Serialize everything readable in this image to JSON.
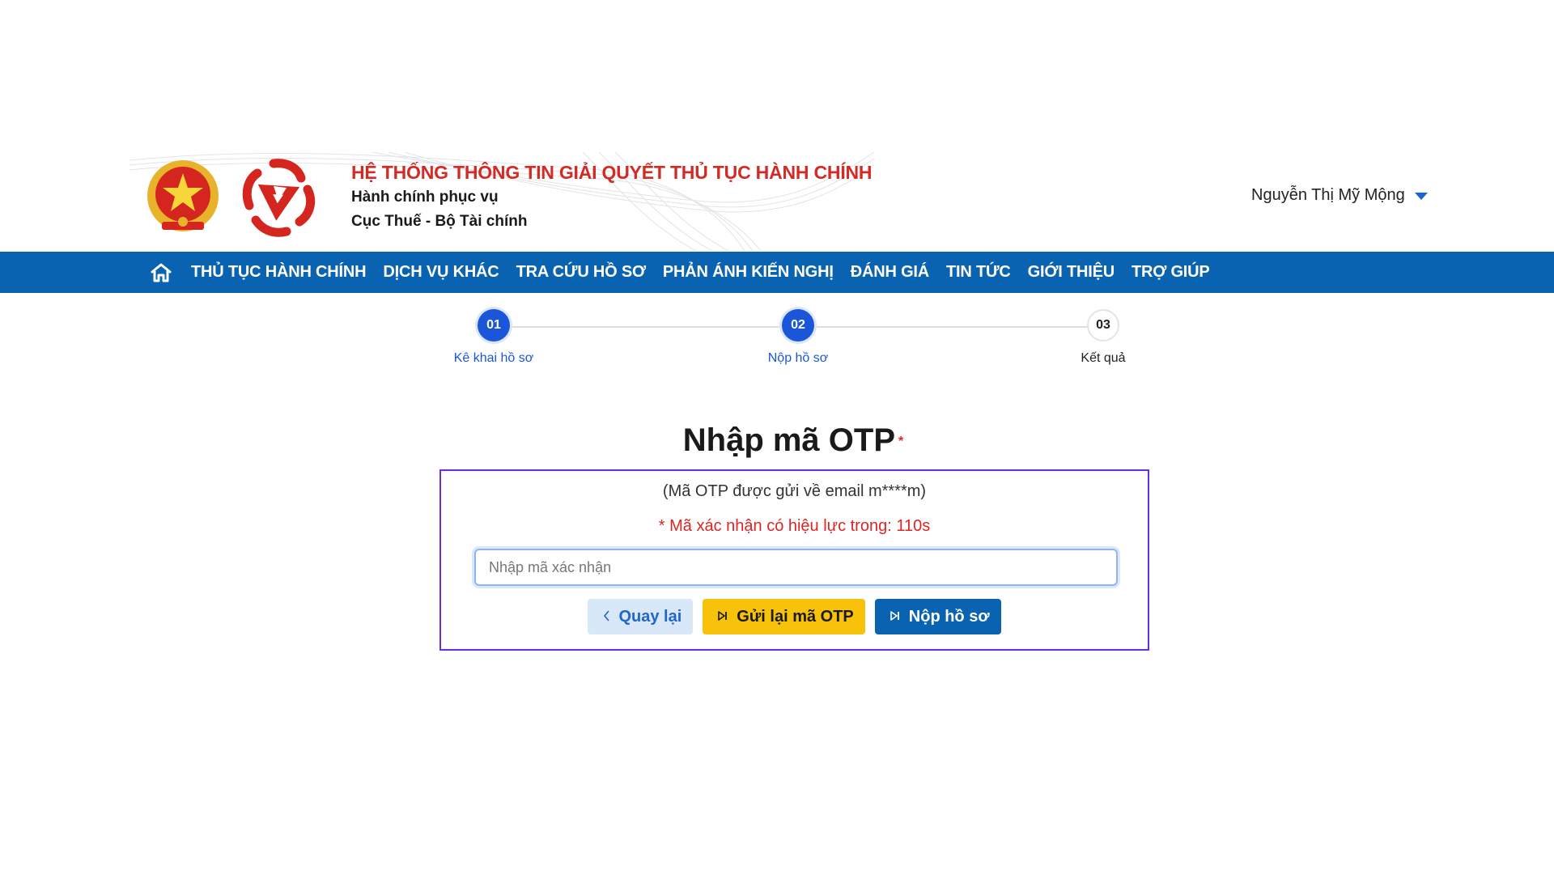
{
  "header": {
    "title": "HỆ THỐNG THÔNG TIN GIẢI QUYẾT THỦ TỤC HÀNH CHÍNH",
    "subtitle1": "Hành chính phục vụ",
    "subtitle2": "Cục Thuế - Bộ Tài chính",
    "user_name": "Nguyễn Thị Mỹ Mộng",
    "title_color": "#d42a24"
  },
  "nav": {
    "background": "#0a63b0",
    "items": [
      {
        "label": "THỦ TỤC HÀNH CHÍNH"
      },
      {
        "label": "DỊCH VỤ KHÁC"
      },
      {
        "label": "TRA CỨU HỒ SƠ"
      },
      {
        "label": "PHẢN ÁNH KIẾN NGHỊ"
      },
      {
        "label": "ĐÁNH GIÁ"
      },
      {
        "label": "TIN TỨC"
      },
      {
        "label": "GIỚI THIỆU"
      },
      {
        "label": "TRỢ GIÚP"
      }
    ]
  },
  "stepper": {
    "steps": [
      {
        "number": "01",
        "label": "Kê khai hồ sơ",
        "state": "active"
      },
      {
        "number": "02",
        "label": "Nộp hồ sơ",
        "state": "active"
      },
      {
        "number": "03",
        "label": "Kết quả",
        "state": "inactive"
      }
    ]
  },
  "otp": {
    "title": "Nhập mã OTP",
    "required_mark": "*",
    "note": "(Mã OTP được gửi về email m****m)",
    "timer_text": "* Mã xác nhận có hiệu lực trong: 110s",
    "input_value": "",
    "input_placeholder": "Nhập mã xác nhận",
    "buttons": {
      "back": "Quay lại",
      "resend": "Gửi lại mã OTP",
      "submit": "Nộp hồ sơ"
    },
    "icons": {
      "back": "chevron-left-icon",
      "resend": "skip-forward-icon",
      "submit": "skip-forward-icon"
    }
  }
}
